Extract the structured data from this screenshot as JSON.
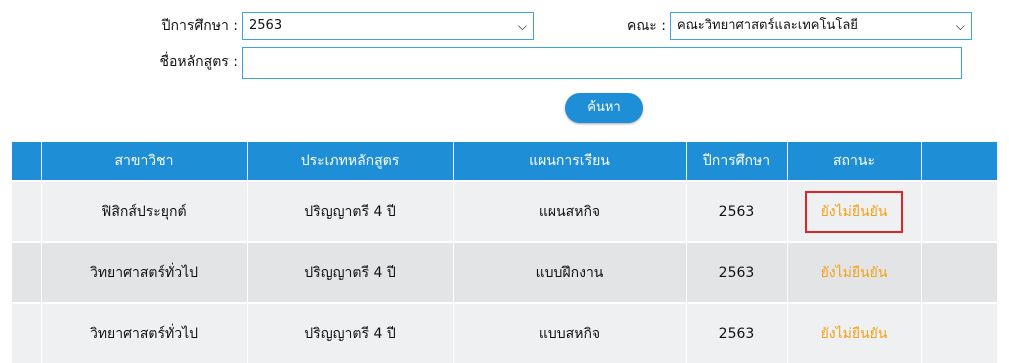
{
  "filters": {
    "year_label": "ปีการศึกษา :",
    "year_value": "2563",
    "faculty_label": "คณะ :",
    "faculty_value": "คณะวิทยาศาสตร์และเทคโนโลยี",
    "course_name_label": "ชื่อหลักสูตร :",
    "course_name_value": "",
    "search_button": "ค้นหา"
  },
  "table": {
    "headers": [
      "",
      "สาขาวิชา",
      "ประเภทหลักสูตร",
      "แผนการเรียน",
      "ปีการศึกษา",
      "สถานะ",
      ""
    ],
    "rows": [
      {
        "major": "ฟิสิกส์ประยุกต์",
        "program_type": "ปริญญาตรี 4 ปี",
        "plan": "แผนสหกิจ",
        "year": "2563",
        "status": "ยังไม่ยืนยัน"
      },
      {
        "major": "วิทยาศาสตร์ทั่วไป",
        "program_type": "ปริญญาตรี 4 ปี",
        "plan": "แบบฝึกงาน",
        "year": "2563",
        "status": "ยังไม่ยืนยัน"
      },
      {
        "major": "วิทยาศาสตร์ทั่วไป",
        "program_type": "ปริญญาตรี 4 ปี",
        "plan": "แบบสหกิจ",
        "year": "2563",
        "status": "ยังไม่ยืนยัน"
      }
    ]
  },
  "colors": {
    "header_bg": "#1e8ed6",
    "status_text": "#f3a21a",
    "highlight_border": "#e0242a",
    "input_border": "#3fa4d9"
  }
}
